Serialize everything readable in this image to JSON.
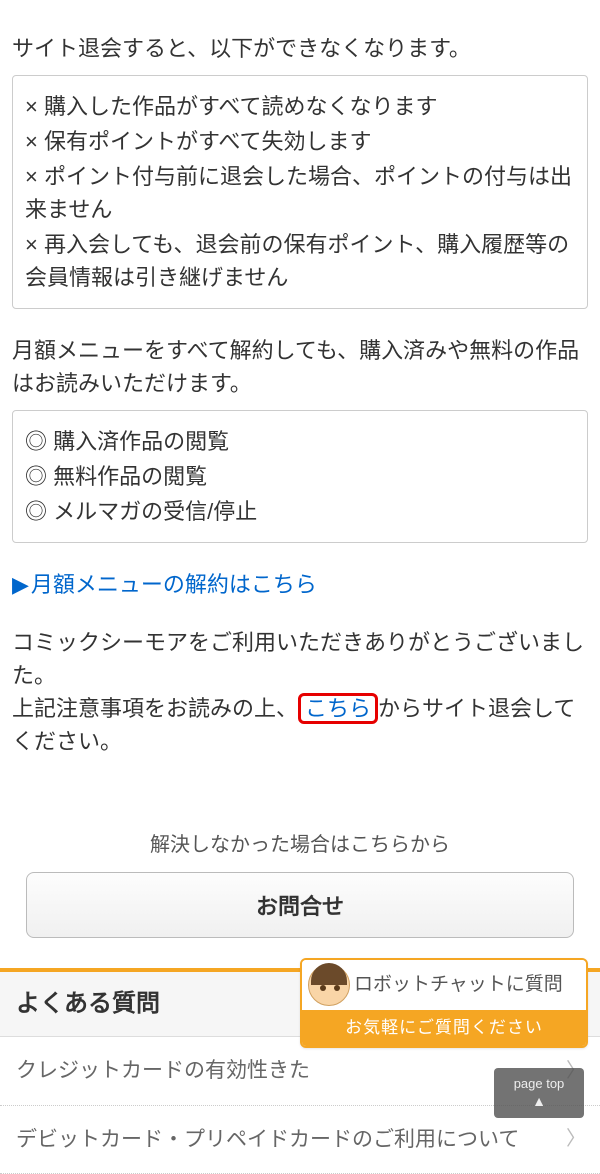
{
  "withdrawal": {
    "intro": "サイト退会すると、以下ができなくなります。",
    "items": [
      "× 購入した作品がすべて読めなくなります",
      "× 保有ポイントがすべて失効します",
      "× ポイント付与前に退会した場合、ポイントの付与は出来ません",
      "× 再入会しても、退会前の保有ポイント、購入履歴等の会員情報は引き継げません"
    ]
  },
  "monthly": {
    "intro": "月額メニューをすべて解約しても、購入済みや無料の作品はお読みいただけます。",
    "items": [
      "◎ 購入済作品の閲覧",
      "◎ 無料作品の閲覧",
      "◎ メルマガの受信/停止"
    ],
    "cancel_link": "月額メニューの解約はこちら"
  },
  "thanks": {
    "line1": "コミックシーモアをご利用いただきありがとうございました。",
    "line2_pre": "上記注意事項をお読みの上、",
    "line2_link": "こちら",
    "line2_post": "からサイト退会してください。"
  },
  "inquiry": {
    "label": "解決しなかった場合はこちらから",
    "button": "お問合せ"
  },
  "faq": {
    "header": "よくある質問",
    "items": [
      "クレジットカードの有効性きた",
      "デビットカード・プリペイドカードのご利用について"
    ]
  },
  "chat": {
    "title": "ロボットチャットに質問",
    "subtitle": "お気軽にご質問ください"
  },
  "page_top": "page top"
}
